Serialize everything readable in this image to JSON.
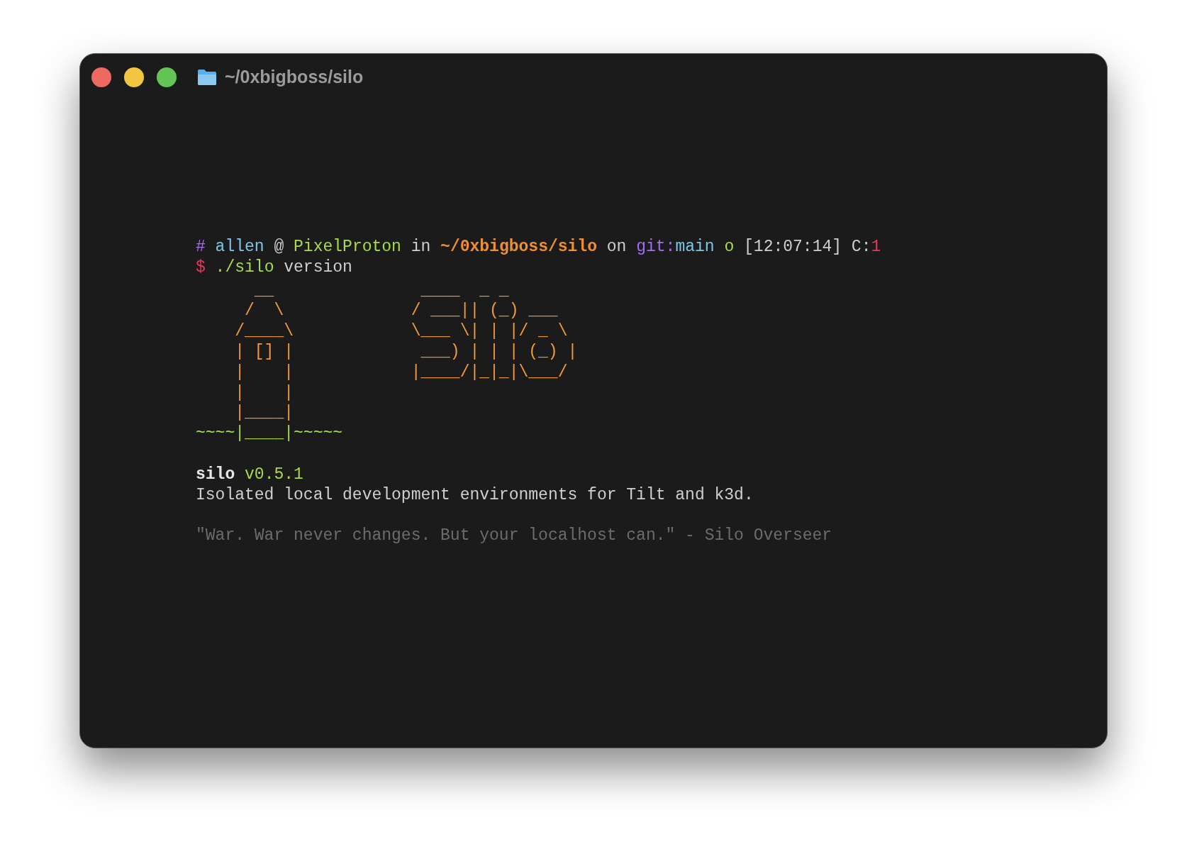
{
  "window": {
    "title": "~/0xbigboss/silo"
  },
  "prompt": [
    {
      "text": "#",
      "color": "#a66cf2"
    },
    {
      "text": " allen",
      "color": "#7cc7ea"
    },
    {
      "text": " @ ",
      "color": "#cfcfcf"
    },
    {
      "text": "PixelProton",
      "color": "#a8dc4a"
    },
    {
      "text": " in ",
      "color": "#cfcfcf"
    },
    {
      "text": "~/0xbigboss/silo",
      "color": "#f08f32",
      "bold": true
    },
    {
      "text": " on ",
      "color": "#cfcfcf"
    },
    {
      "text": "git:",
      "color": "#a66cf2"
    },
    {
      "text": "main",
      "color": "#7cc7ea"
    },
    {
      "text": " o",
      "color": "#a8dc4a"
    },
    {
      "text": " [12:07:14] C:",
      "color": "#cfcfcf"
    },
    {
      "text": "1",
      "color": "#e8365d"
    }
  ],
  "command": [
    {
      "text": "$",
      "color": "#e8365d"
    },
    {
      "text": " ./silo",
      "color": "#a8dc4a"
    },
    {
      "text": " version",
      "color": "#cfcfcf"
    }
  ],
  "lighthouse_art": [
    {
      "text": "      __",
      "color": "#f09a3e"
    },
    {
      "text": "     /  \\",
      "color": "#f09a3e"
    },
    {
      "text": "    /____\\",
      "color": "#f09a3e"
    },
    {
      "text": "    | [] |",
      "color": "#f09a3e"
    },
    {
      "text": "    |    |",
      "color": "#f09a3e"
    },
    {
      "text": "    |    |",
      "color": "#f09a3e"
    },
    {
      "text": "    |____|",
      "color": "#f09a3e"
    },
    {
      "text": "~~~~|____|~~~~~",
      "color": "#a8dc4a"
    }
  ],
  "logo_art": [
    " ____  _ _",
    "/ ___|| (_) ___",
    "\\___ \\| | |/ _ \\",
    " ___) | | | (_) |",
    "|____/|_|_|\\___/"
  ],
  "version": {
    "name": "silo",
    "number": "v0.5.1"
  },
  "description": "Isolated local development environments for Tilt and k3d.",
  "quote": "\"War. War never changes. But your localhost can.\" - Silo Overseer"
}
